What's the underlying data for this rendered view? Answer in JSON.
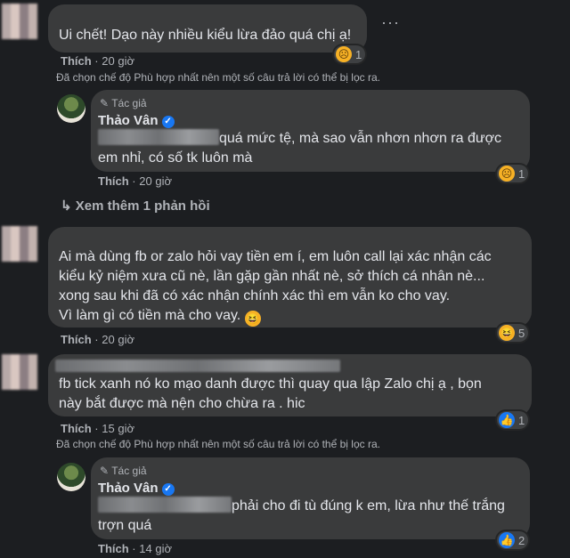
{
  "comments": [
    {
      "text_lines": [
        "Ui chết! Dạo này nhiều kiểu lừa đảo quá chị ạ!"
      ],
      "like_label": "Thích",
      "time": "20 giờ",
      "reaction_count": "1"
    },
    {
      "text_lines": [
        "Ai mà dùng fb or zalo hỏi vay tiền em í, em luôn call lại xác nhận các",
        "kiểu kỷ niệm xưa cũ nè, lần gặp gần nhất nè, sở thích cá nhân nè...",
        "xong sau khi đã có xác nhận chính xác thì em vẫn ko cho vay.",
        "Vì làm gì có tiền mà cho vay."
      ],
      "like_label": "Thích",
      "time": "20 giờ",
      "reaction_count": "5"
    },
    {
      "text_lines": [
        "fb tick xanh nó ko mạo danh được thì quay qua lập Zalo chị ạ , bọn",
        "này bắt được mà nện cho chừa ra . hic"
      ],
      "like_label": "Thích",
      "time": "15 giờ",
      "reaction_count": "1"
    }
  ],
  "filter_notice": "Đã chọn chế độ Phù hợp nhất nên một số câu trả lời có thể bị lọc ra.",
  "replies": [
    {
      "badge": "Tác giả",
      "name": "Thảo Vân",
      "text_line1": "quá mức tệ, mà sao vẫn nhơn nhơn ra được",
      "text_line2": "em nhỉ, có số tk luôn mà",
      "like_label": "Thích",
      "time": "20 giờ",
      "reaction_count": "1"
    },
    {
      "badge": "Tác giả",
      "name": "Thảo Vân",
      "text_line1": "phải cho đi tù đúng k em, lừa như thế trắng",
      "text_line2": "trợn quá",
      "like_label": "Thích",
      "time": "14 giờ",
      "reaction_count": "2"
    }
  ],
  "more_replies": "Xem thêm 1 phản hồi",
  "separator": "·",
  "icons": {
    "sad": "sad-reaction-icon",
    "haha": "haha-reaction-icon",
    "like": "like-reaction-icon",
    "reply_arrow": "reply-arrow-icon",
    "verified": "verified-badge-icon",
    "more": "more-options-icon",
    "author_pencil": "author-pencil-icon"
  }
}
